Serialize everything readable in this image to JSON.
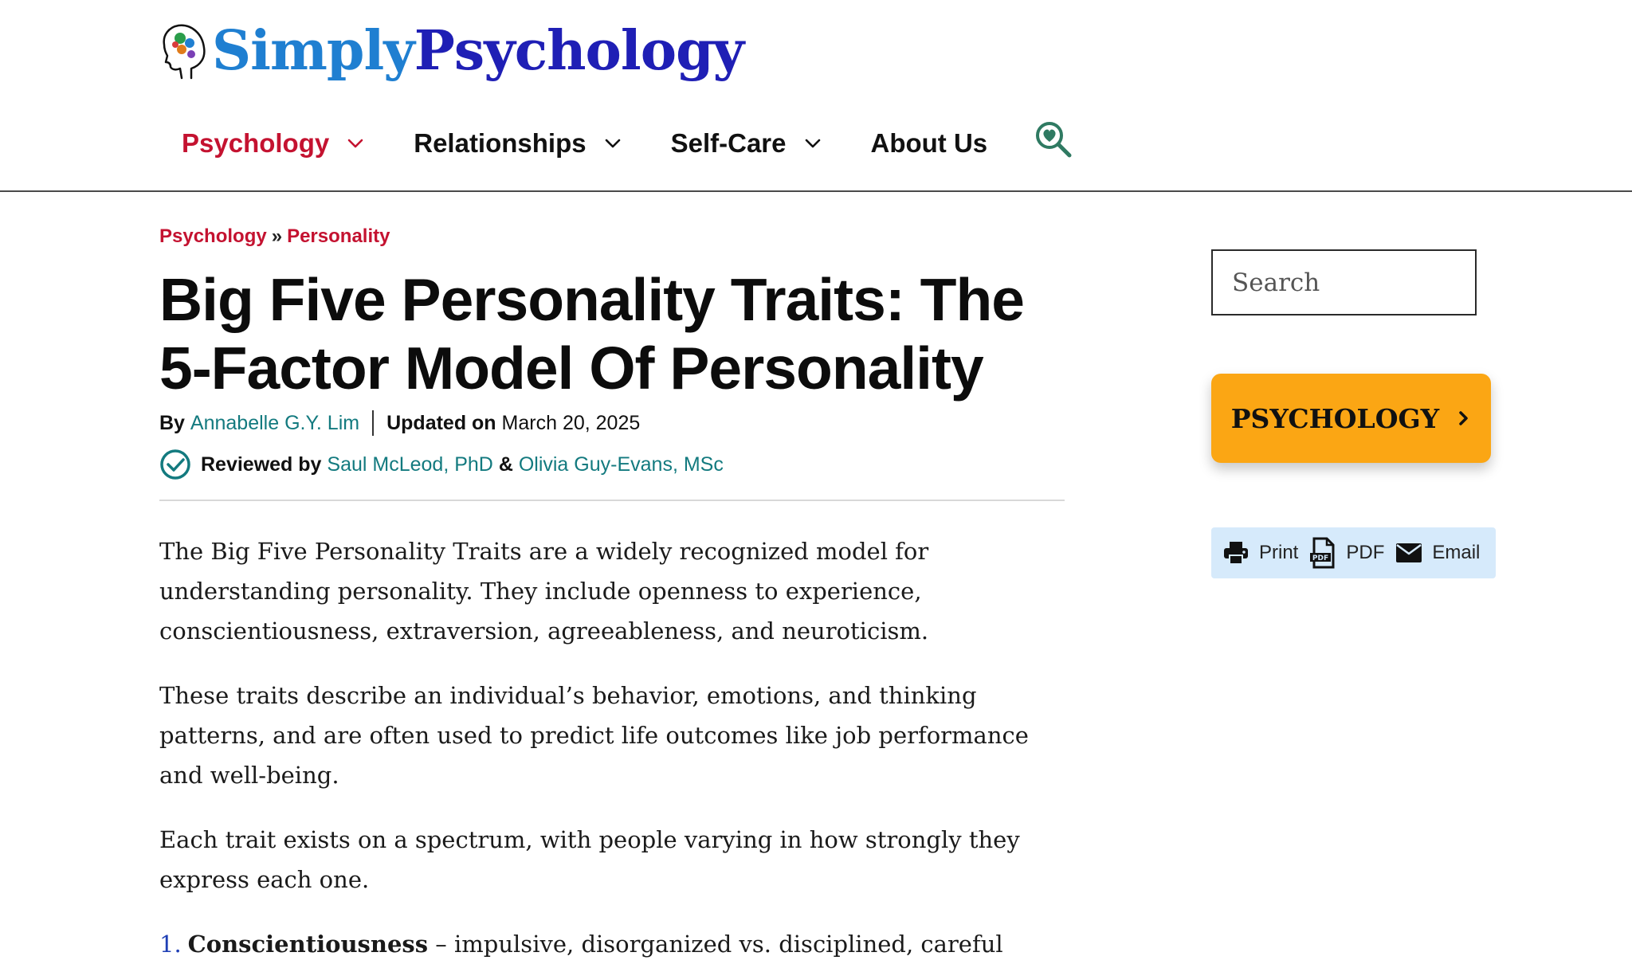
{
  "brand": {
    "part1": "Simply",
    "part2": "Psychology",
    "color_part1": "#1f7fd1",
    "color_part2": "#1f1fb5",
    "icon": "head-gears-logo-icon"
  },
  "nav": {
    "items": [
      {
        "label": "Psychology",
        "has_dropdown": true,
        "active": true
      },
      {
        "label": "Relationships",
        "has_dropdown": true,
        "active": false
      },
      {
        "label": "Self-Care",
        "has_dropdown": true,
        "active": false
      },
      {
        "label": "About Us",
        "has_dropdown": false,
        "active": false
      }
    ],
    "search_icon": "heart-search-icon",
    "active_color": "#c41230"
  },
  "breadcrumb": {
    "items": [
      "Psychology",
      "Personality"
    ],
    "separator": "»"
  },
  "article": {
    "title": "Big Five Personality Traits: The 5-Factor Model Of Personality",
    "by_label": "By",
    "author": "Annabelle G.Y. Lim",
    "updated_label": "Updated on",
    "updated_date": "March 20, 2025",
    "reviewed_label": "Reviewed by",
    "reviewers": [
      "Saul McLeod, PhD",
      "Olivia Guy-Evans, MSc"
    ],
    "reviewer_joiner": "&",
    "link_color": "#137a7f",
    "paragraphs": [
      "The Big Five Personality Traits are a widely recognized model for understanding personality. They include openness to experience, conscientiousness, extraversion, agreeableness, and neuroticism.",
      "These traits describe an individual’s behavior, emotions, and thinking patterns, and are often used to predict life outcomes like job performance and well-being.",
      "Each trait exists on a spectrum, with people varying in how strongly they express each one."
    ],
    "list": [
      {
        "num": "1.",
        "name": "Conscientiousness",
        "desc": "– impulsive, disorganized vs. disciplined, careful"
      }
    ]
  },
  "sidebar": {
    "search_placeholder": "Search",
    "category_button": "PSYCHOLOGY",
    "category_color": "#fba614",
    "share": [
      {
        "label": "Print",
        "icon": "printer-icon"
      },
      {
        "label": "PDF",
        "icon": "pdf-file-icon"
      },
      {
        "label": "Email",
        "icon": "envelope-icon"
      }
    ],
    "share_bg": "#d6eafb"
  }
}
